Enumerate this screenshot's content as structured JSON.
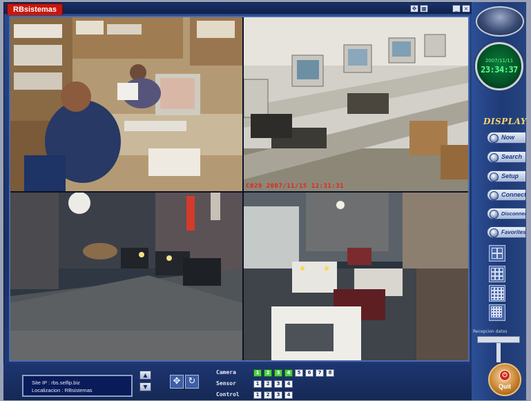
{
  "window": {
    "title": "RBsistemas",
    "controls": [
      "move",
      "grid",
      "minimize",
      "close"
    ]
  },
  "cameras": [
    {
      "id": 1,
      "overlay": ""
    },
    {
      "id": 2,
      "overlay": "C029 2007/11/15 12:31:31"
    },
    {
      "id": 3,
      "overlay": ""
    },
    {
      "id": 4,
      "overlay": ""
    }
  ],
  "clock": {
    "date": "2007/11/11",
    "time": "23:34:37"
  },
  "sidebar": {
    "display_label": "DISPLAY",
    "buttons": [
      {
        "label": "Now"
      },
      {
        "label": "Search"
      },
      {
        "label": "Setup"
      },
      {
        "label": "Connect"
      },
      {
        "label": "Disconnect"
      },
      {
        "label": "Favorites"
      }
    ],
    "layouts": [
      "1x1",
      "2x2",
      "3x3",
      "4x4"
    ],
    "record_label": "Recepcion datos",
    "quit_label": "Quit"
  },
  "info": {
    "site_ip": "Site IP : rbs.selfip.biz",
    "location": "Localizacion : RBsistemas"
  },
  "controls": {
    "camera_label": "Camera",
    "sensor_label": "Sensor",
    "control_label": "Control",
    "camera_buttons": [
      {
        "n": "1",
        "active": true
      },
      {
        "n": "2",
        "active": true
      },
      {
        "n": "3",
        "active": true
      },
      {
        "n": "4",
        "active": true
      },
      {
        "n": "5",
        "active": false
      },
      {
        "n": "6",
        "active": false
      },
      {
        "n": "7",
        "active": false
      },
      {
        "n": "8",
        "active": false
      }
    ],
    "sensor_buttons": [
      "1",
      "2",
      "3",
      "4"
    ],
    "control_buttons": [
      "1",
      "2",
      "3",
      "4"
    ]
  },
  "colors": {
    "frame": "#1b2f63",
    "title_tab": "#c8180d",
    "clock_digits": "#5dff8c",
    "display_label": "#f3d46a",
    "camera_active": "#4fcf47"
  }
}
